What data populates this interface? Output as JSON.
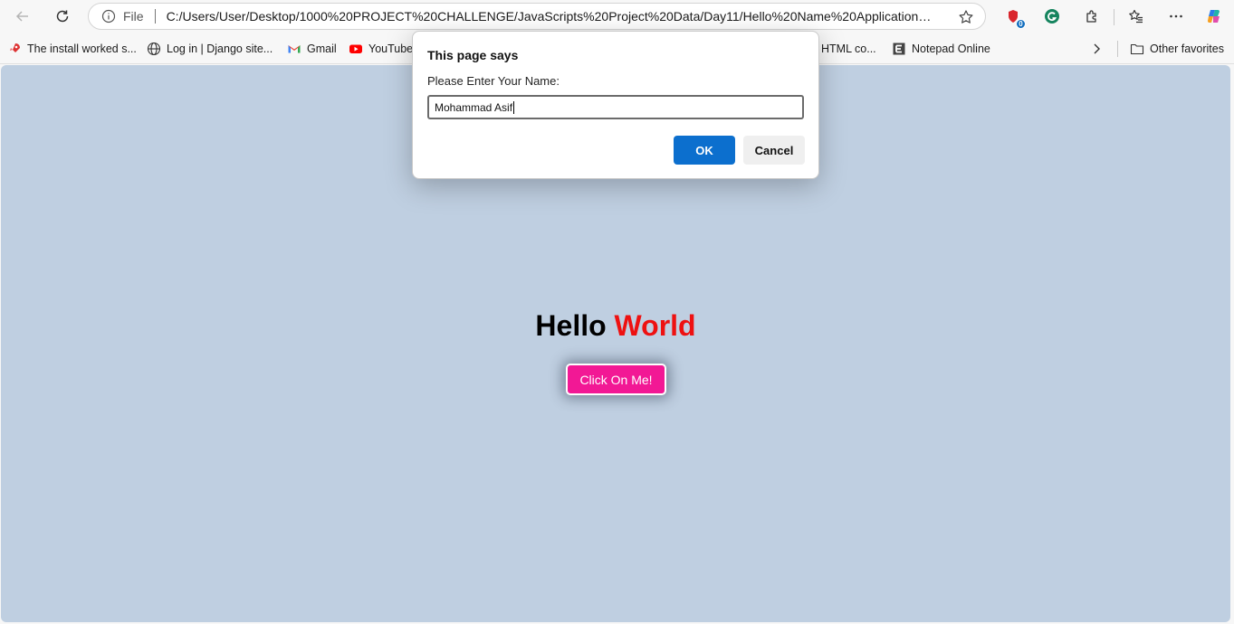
{
  "address_bar": {
    "scheme_label": "File",
    "url": "C:/Users/User/Desktop/1000%20PROJECT%20CHALLENGE/JavaScripts%20Project%20Data/Day11/Hello%20Name%20Applications%20..."
  },
  "extensions": {
    "notification_count": "0"
  },
  "bookmarks": {
    "items": [
      {
        "label": "The install worked s..."
      },
      {
        "label": "Log in | Django site..."
      },
      {
        "label": "Gmail"
      },
      {
        "label": "YouTube"
      },
      {
        "label": "HTML co..."
      },
      {
        "label": "Notepad Online"
      }
    ],
    "other_favorites": "Other favorites"
  },
  "page": {
    "title_word1": "Hello",
    "title_word2": "World",
    "button_label": "Click On Me!",
    "accent_color": "#ee1111",
    "button_color": "#f21895",
    "background_color": "#bfcfe1"
  },
  "dialog": {
    "title": "This page says",
    "message": "Please Enter Your Name:",
    "input_value": "Mohammad Asif",
    "ok_label": "OK",
    "cancel_label": "Cancel"
  }
}
